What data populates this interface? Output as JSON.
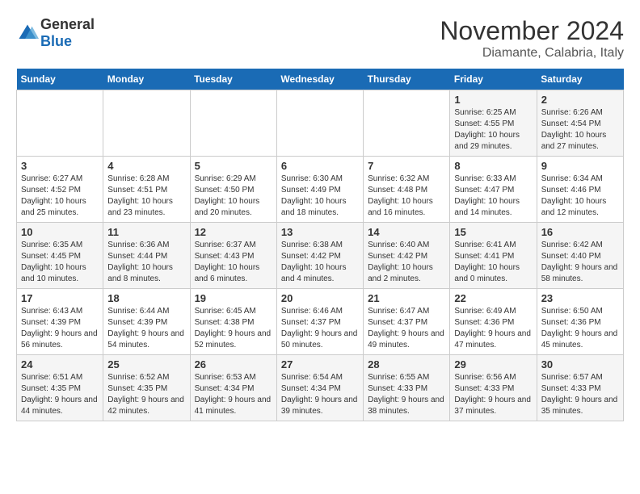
{
  "header": {
    "logo_general": "General",
    "logo_blue": "Blue",
    "title": "November 2024",
    "subtitle": "Diamante, Calabria, Italy"
  },
  "weekdays": [
    "Sunday",
    "Monday",
    "Tuesday",
    "Wednesday",
    "Thursday",
    "Friday",
    "Saturday"
  ],
  "weeks": [
    [
      {
        "day": "",
        "info": ""
      },
      {
        "day": "",
        "info": ""
      },
      {
        "day": "",
        "info": ""
      },
      {
        "day": "",
        "info": ""
      },
      {
        "day": "",
        "info": ""
      },
      {
        "day": "1",
        "info": "Sunrise: 6:25 AM\nSunset: 4:55 PM\nDaylight: 10 hours and 29 minutes."
      },
      {
        "day": "2",
        "info": "Sunrise: 6:26 AM\nSunset: 4:54 PM\nDaylight: 10 hours and 27 minutes."
      }
    ],
    [
      {
        "day": "3",
        "info": "Sunrise: 6:27 AM\nSunset: 4:52 PM\nDaylight: 10 hours and 25 minutes."
      },
      {
        "day": "4",
        "info": "Sunrise: 6:28 AM\nSunset: 4:51 PM\nDaylight: 10 hours and 23 minutes."
      },
      {
        "day": "5",
        "info": "Sunrise: 6:29 AM\nSunset: 4:50 PM\nDaylight: 10 hours and 20 minutes."
      },
      {
        "day": "6",
        "info": "Sunrise: 6:30 AM\nSunset: 4:49 PM\nDaylight: 10 hours and 18 minutes."
      },
      {
        "day": "7",
        "info": "Sunrise: 6:32 AM\nSunset: 4:48 PM\nDaylight: 10 hours and 16 minutes."
      },
      {
        "day": "8",
        "info": "Sunrise: 6:33 AM\nSunset: 4:47 PM\nDaylight: 10 hours and 14 minutes."
      },
      {
        "day": "9",
        "info": "Sunrise: 6:34 AM\nSunset: 4:46 PM\nDaylight: 10 hours and 12 minutes."
      }
    ],
    [
      {
        "day": "10",
        "info": "Sunrise: 6:35 AM\nSunset: 4:45 PM\nDaylight: 10 hours and 10 minutes."
      },
      {
        "day": "11",
        "info": "Sunrise: 6:36 AM\nSunset: 4:44 PM\nDaylight: 10 hours and 8 minutes."
      },
      {
        "day": "12",
        "info": "Sunrise: 6:37 AM\nSunset: 4:43 PM\nDaylight: 10 hours and 6 minutes."
      },
      {
        "day": "13",
        "info": "Sunrise: 6:38 AM\nSunset: 4:42 PM\nDaylight: 10 hours and 4 minutes."
      },
      {
        "day": "14",
        "info": "Sunrise: 6:40 AM\nSunset: 4:42 PM\nDaylight: 10 hours and 2 minutes."
      },
      {
        "day": "15",
        "info": "Sunrise: 6:41 AM\nSunset: 4:41 PM\nDaylight: 10 hours and 0 minutes."
      },
      {
        "day": "16",
        "info": "Sunrise: 6:42 AM\nSunset: 4:40 PM\nDaylight: 9 hours and 58 minutes."
      }
    ],
    [
      {
        "day": "17",
        "info": "Sunrise: 6:43 AM\nSunset: 4:39 PM\nDaylight: 9 hours and 56 minutes."
      },
      {
        "day": "18",
        "info": "Sunrise: 6:44 AM\nSunset: 4:39 PM\nDaylight: 9 hours and 54 minutes."
      },
      {
        "day": "19",
        "info": "Sunrise: 6:45 AM\nSunset: 4:38 PM\nDaylight: 9 hours and 52 minutes."
      },
      {
        "day": "20",
        "info": "Sunrise: 6:46 AM\nSunset: 4:37 PM\nDaylight: 9 hours and 50 minutes."
      },
      {
        "day": "21",
        "info": "Sunrise: 6:47 AM\nSunset: 4:37 PM\nDaylight: 9 hours and 49 minutes."
      },
      {
        "day": "22",
        "info": "Sunrise: 6:49 AM\nSunset: 4:36 PM\nDaylight: 9 hours and 47 minutes."
      },
      {
        "day": "23",
        "info": "Sunrise: 6:50 AM\nSunset: 4:36 PM\nDaylight: 9 hours and 45 minutes."
      }
    ],
    [
      {
        "day": "24",
        "info": "Sunrise: 6:51 AM\nSunset: 4:35 PM\nDaylight: 9 hours and 44 minutes."
      },
      {
        "day": "25",
        "info": "Sunrise: 6:52 AM\nSunset: 4:35 PM\nDaylight: 9 hours and 42 minutes."
      },
      {
        "day": "26",
        "info": "Sunrise: 6:53 AM\nSunset: 4:34 PM\nDaylight: 9 hours and 41 minutes."
      },
      {
        "day": "27",
        "info": "Sunrise: 6:54 AM\nSunset: 4:34 PM\nDaylight: 9 hours and 39 minutes."
      },
      {
        "day": "28",
        "info": "Sunrise: 6:55 AM\nSunset: 4:33 PM\nDaylight: 9 hours and 38 minutes."
      },
      {
        "day": "29",
        "info": "Sunrise: 6:56 AM\nSunset: 4:33 PM\nDaylight: 9 hours and 37 minutes."
      },
      {
        "day": "30",
        "info": "Sunrise: 6:57 AM\nSunset: 4:33 PM\nDaylight: 9 hours and 35 minutes."
      }
    ]
  ]
}
